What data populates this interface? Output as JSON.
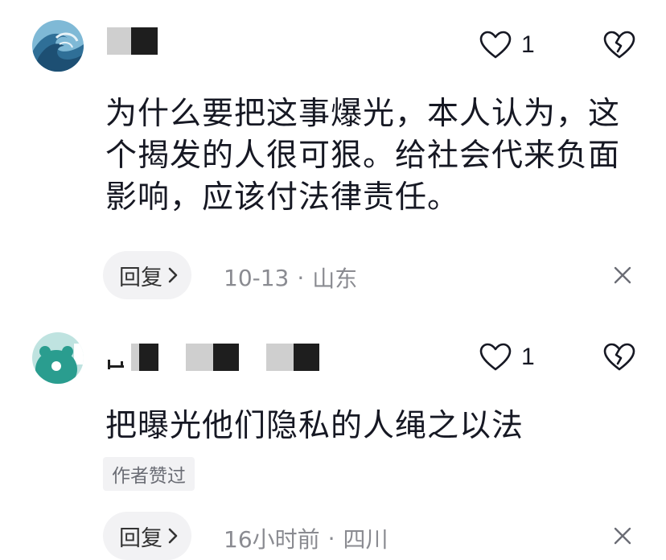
{
  "comments": [
    {
      "like_count": "1",
      "text": "为什么要把这事爆光，本人认为，这个揭发的人很可狠。给社会代来负面影响，应该付法律责任。",
      "reply_label": "回复",
      "date": "10-13",
      "separator": "·",
      "location": "山东"
    },
    {
      "like_count": "1",
      "text": "把曝光他们隐私的人绳之以法",
      "author_tag": "作者赞过",
      "reply_label": "回复",
      "date": "16小时前",
      "separator": "·",
      "location": "四川"
    }
  ],
  "icons": {
    "like": "heart-outline-icon",
    "dislike": "broken-heart-icon",
    "reply_arrow": "chevron-right-icon",
    "close": "close-icon"
  },
  "colors": {
    "text": "#161823",
    "meta": "#8a8b91",
    "pill_bg": "#f2f2f4"
  }
}
